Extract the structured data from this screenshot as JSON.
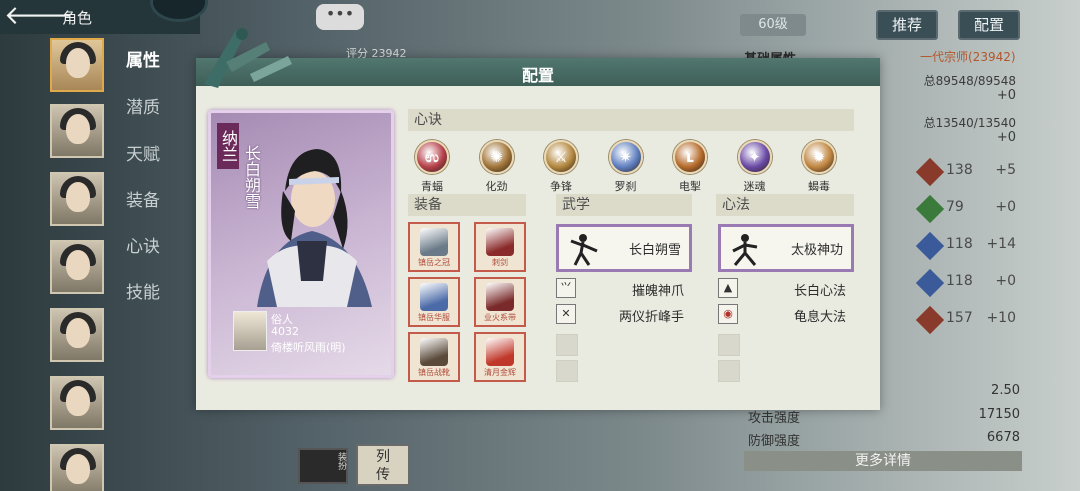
{
  "nav": {
    "back_label": "🡐",
    "tab_title": "角色"
  },
  "background": {
    "chat_bubble": "•••",
    "score_label": "评分",
    "score_value": "23942",
    "side_tabs": [
      "属性",
      "潜质",
      "天赋",
      "装备",
      "心诀",
      "技能"
    ],
    "level_badge": "60级",
    "recommend_label": "推荐",
    "config_label": "配置",
    "base_attr_label": "基础属性",
    "rank_title": "一代宗师(23942)",
    "totals": [
      {
        "prefix": "总",
        "current": "89548",
        "max": "89548"
      },
      {
        "prefix": "总",
        "current": "13540",
        "max": "13540"
      }
    ],
    "total_bonus": [
      "+0",
      "+0"
    ],
    "stats": [
      {
        "value": "138",
        "bonus": "+5"
      },
      {
        "value": "79",
        "bonus": "+0"
      },
      {
        "value": "118",
        "bonus": "+14"
      },
      {
        "value": "118",
        "bonus": "+0"
      },
      {
        "value": "157",
        "bonus": "+10"
      }
    ],
    "lower_rows": [
      {
        "label": "",
        "value": "2.50"
      },
      {
        "label": "攻击强度",
        "value": "17150"
      },
      {
        "label": "防御强度",
        "value": "6678"
      }
    ],
    "more_details": "更多详情",
    "dock": {
      "a_label": "装扮",
      "b_line1": "列",
      "b_line2": "传"
    }
  },
  "dialog": {
    "title": "配置",
    "character": {
      "name_top": "纳兰",
      "name_side": "长白朔雪",
      "identity": "俗人",
      "power": "4032",
      "source": "倚楼听风雨(明)"
    },
    "sections": {
      "xinjue": "心诀",
      "equipment": "装备",
      "wuxue": "武学",
      "xinfa": "心法"
    },
    "xinjue": [
      {
        "label": "青蝠",
        "icon": "bat-icon",
        "glyph": "ಉ",
        "color": "#b5404a"
      },
      {
        "label": "化劲",
        "icon": "swirl-icon",
        "glyph": "✺",
        "color": "#a07438"
      },
      {
        "label": "争锋",
        "icon": "blade-icon",
        "glyph": "⚔",
        "color": "#b3873e"
      },
      {
        "label": "罗刹",
        "icon": "rakshasa-icon",
        "glyph": "✷",
        "color": "#5f7fc0"
      },
      {
        "label": "电掣",
        "icon": "lightning-icon",
        "glyph": "ʟ",
        "color": "#b56a2a"
      },
      {
        "label": "迷魂",
        "icon": "charm-icon",
        "glyph": "✦",
        "color": "#6a4aa6"
      },
      {
        "label": "蝎毒",
        "icon": "scorpion-icon",
        "glyph": "✹",
        "color": "#c08540"
      }
    ],
    "equipment": [
      {
        "label": "镇岳之冠",
        "icon": "crown-icon",
        "color": "#6a7a88"
      },
      {
        "label": "刺剑",
        "icon": "sword-icon",
        "color": "#8a2a2a"
      },
      {
        "label": "镇岳华服",
        "icon": "armor-icon",
        "color": "#4a6aa8"
      },
      {
        "label": "业火系带",
        "icon": "belt-icon",
        "color": "#7a2a2a"
      },
      {
        "label": "镇岳战靴",
        "icon": "boots-icon",
        "color": "#5a4a3a"
      },
      {
        "label": "清月金辉",
        "icon": "ring-icon",
        "color": "#c0382a"
      }
    ],
    "wuxue": {
      "main": "长白朔雪",
      "list": [
        {
          "name": "摧魄神爪",
          "icon": "claw-icon",
          "glyph": "⺍"
        },
        {
          "name": "两仪折峰手",
          "icon": "palm-icon",
          "glyph": "✕"
        }
      ]
    },
    "xinfa": {
      "main": "太极神功",
      "list": [
        {
          "name": "长白心法",
          "icon": "meditation-icon",
          "glyph": "▲"
        },
        {
          "name": "龟息大法",
          "icon": "turtle-icon",
          "glyph": "◉"
        }
      ]
    }
  }
}
